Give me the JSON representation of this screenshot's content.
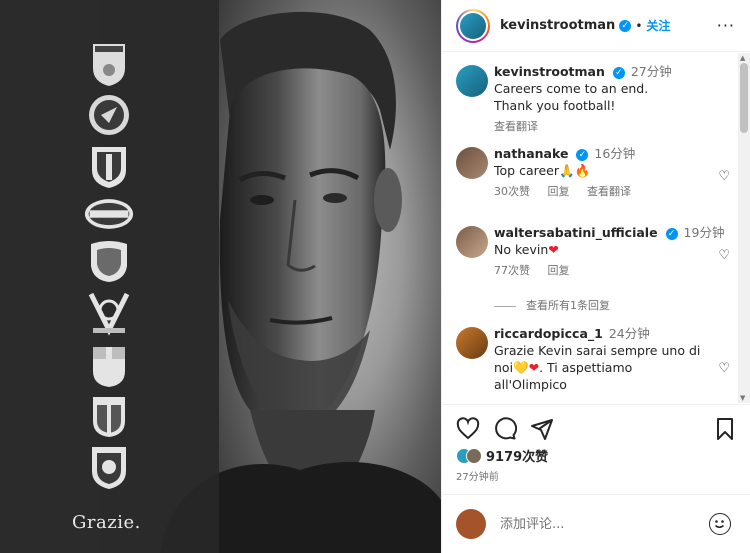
{
  "post": {
    "author": "kevinstrootman",
    "follow_label": "关注",
    "dot": "•",
    "more_label": "···",
    "media_caption": "Grazie."
  },
  "caption": {
    "user": "kevinstrootman",
    "time": "27分钟",
    "text_line1": "Careers come to an end.",
    "text_line2": "Thank you football!",
    "translate": "查看翻译"
  },
  "comments": [
    {
      "user": "nathanake",
      "time": "16分钟",
      "text": "Top career🙏🔥",
      "likes": "30次赞",
      "reply": "回复",
      "translate": "查看翻译"
    },
    {
      "user": "waltersabatini_ufficiale",
      "time": "19分钟",
      "text": "No kevin",
      "heart": "❤",
      "likes": "77次赞",
      "reply": "回复"
    },
    {
      "user": "riccardopicca_1",
      "time": "24分钟",
      "text_line1": "Grazie Kevin sarai sempre uno di",
      "text_line2": "noi💛",
      "heart": "❤",
      "text_line2b": ". Ti aspettiamo",
      "text_line3": "all'Olimpico"
    }
  ],
  "view_replies": "查看所有1条回复",
  "likes_count": "9179次赞",
  "post_time": "27分钟前",
  "composer": {
    "placeholder": "添加评论..."
  },
  "crests": [
    "ASV Risdorp",
    "Sparta",
    "FC Utrecht",
    "PSV",
    "AS Roma",
    "Olympique de Marseille",
    "Genoa",
    "Cagliari",
    "Lecce"
  ],
  "colors": {
    "accent": "#0095f6",
    "heart": "#ed1c2e",
    "muted": "#737373"
  }
}
